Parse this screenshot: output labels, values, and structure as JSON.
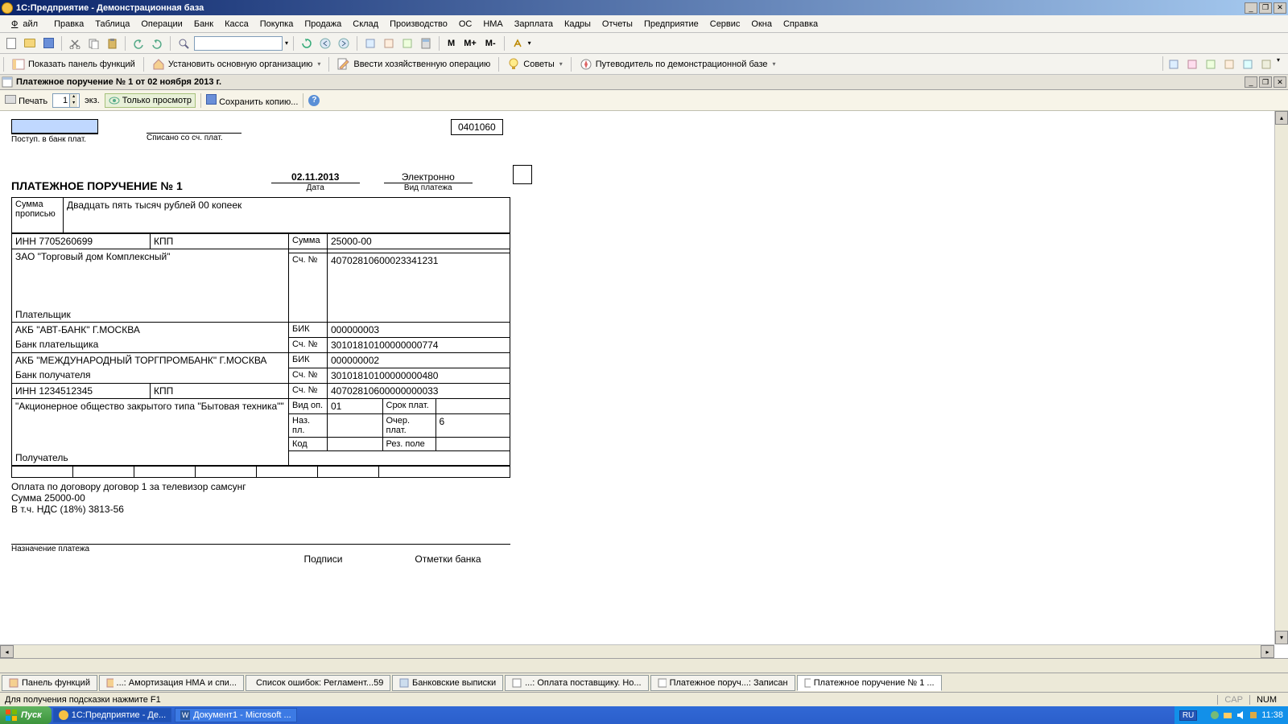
{
  "app": {
    "title": "1С:Предприятие - Демонстрационная база"
  },
  "menu": {
    "file": "Файл",
    "edit": "Правка",
    "table": "Таблица",
    "operations": "Операции",
    "bank": "Банк",
    "cash": "Касса",
    "purchase": "Покупка",
    "sale": "Продажа",
    "warehouse": "Склад",
    "production": "Производство",
    "os": "ОС",
    "nma": "НМА",
    "salary": "Зарплата",
    "personnel": "Кадры",
    "reports": "Отчеты",
    "enterprise": "Предприятие",
    "service": "Сервис",
    "windows": "Окна",
    "help": "Справка"
  },
  "toolbar_memory": {
    "m": "M",
    "mplus": "M+",
    "mminus": "M-"
  },
  "toolbar2": {
    "func_panel": "Показать панель функций",
    "set_org": "Установить основную организацию",
    "input_op": "Ввести хозяйственную операцию",
    "tips": "Советы",
    "guide": "Путеводитель по демонстрационной базе"
  },
  "doc": {
    "tab_title": "Платежное поручение № 1 от 02 ноября 2013 г.",
    "print": "Печать",
    "copies": "1",
    "copies_suffix": "экз.",
    "view_only": "Только просмотр",
    "save_copy": "Сохранить копию..."
  },
  "form": {
    "received_label": "Поступ. в банк плат.",
    "written_label": "Списано со сч. плат.",
    "code": "0401060",
    "title": "ПЛАТЕЖНОЕ ПОРУЧЕНИЕ № 1",
    "date": "02.11.2013",
    "date_lbl": "Дата",
    "pay_type": "Электронно",
    "pay_type_lbl": "Вид платежа",
    "sum_words_lbl": "Сумма прописью",
    "sum_words": "Двадцать пять тысяч рублей 00 копеек",
    "inn_lbl": "ИНН",
    "inn1": "7705260699",
    "kpp_lbl": "КПП",
    "sum_lbl": "Сумма",
    "sum_val": "25000-00",
    "payer_name": "ЗАО \"Торговый дом Комплексный\"",
    "acc_lbl": "Сч. №",
    "payer_acc": "40702810600023341231",
    "payer_lbl": "Плательщик",
    "payer_bank": "АКБ \"АВТ-БАНК\" Г.МОСКВА",
    "bik_lbl": "БИК",
    "bik1": "000000003",
    "corr1": "30101810100000000774",
    "payer_bank_lbl": "Банк плательщика",
    "rec_bank": "АКБ \"МЕЖДУНАРОДНЫЙ ТОРГПРОМБАНК\" Г.МОСКВА",
    "bik2": "000000002",
    "corr2": "30101810100000000480",
    "rec_bank_lbl": "Банк получателя",
    "inn2": "1234512345",
    "rec_acc": "40702810600000000033",
    "rec_name": "\"Акционерное общество закрытого типа \"Бытовая техника\"\"",
    "vidop_lbl": "Вид оп.",
    "vidop": "01",
    "srok_lbl": "Срок плат.",
    "nazpl_lbl": "Наз. пл.",
    "ocher_lbl": "Очер. плат.",
    "ocher": "6",
    "kod_lbl": "Код",
    "rezp_lbl": "Рез. поле",
    "receiver_lbl": "Получатель",
    "purpose1": "Оплата по договору договор 1 за телевизор самсунг",
    "purpose2": "Сумма 25000-00",
    "purpose3": "В т.ч. НДС  (18%) 3813-56",
    "purpose_lbl": "Назначение платежа",
    "sign_lbl": "Подписи",
    "bank_marks_lbl": "Отметки банка"
  },
  "wtabs": {
    "t1": "Панель функций",
    "t2": "...: Амортизация НМА и спи...",
    "t3": "Список ошибок: Регламент...59",
    "t4": "Банковские выписки",
    "t5": "...: Оплата поставщику. Но...",
    "t6": "Платежное поруч...: Записан",
    "t7": "Платежное поручение № 1 ..."
  },
  "status": {
    "hint": "Для получения подсказки нажмите F1",
    "cap": "CAP",
    "num": "NUM"
  },
  "taskbar": {
    "start": "Пуск",
    "t1": "1С:Предприятие - Де...",
    "t2": "Документ1 - Microsoft ...",
    "ru": "RU",
    "time": "11:38"
  }
}
